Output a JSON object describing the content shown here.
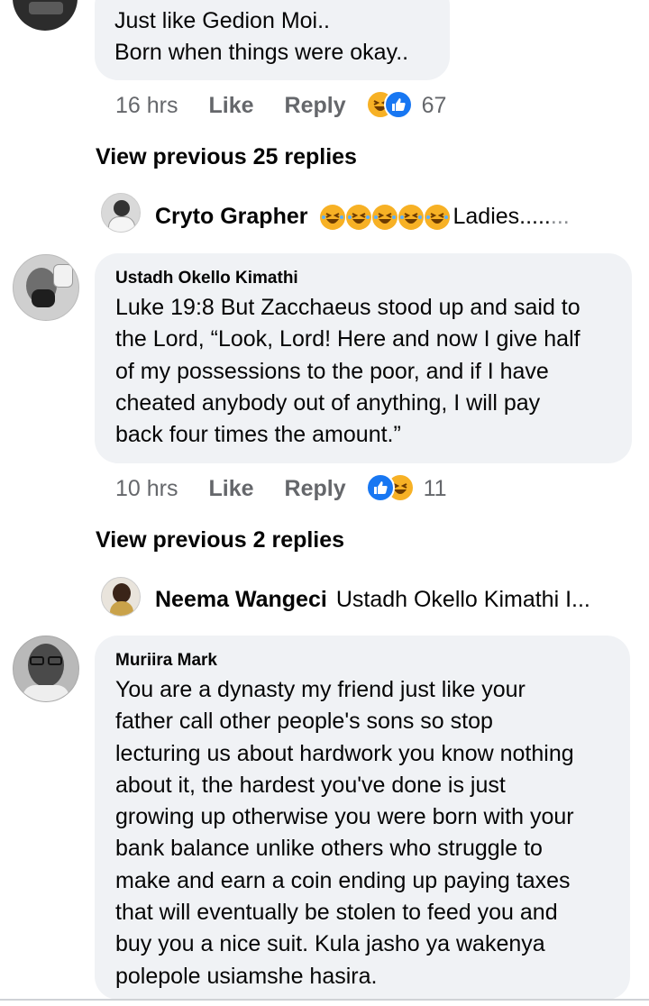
{
  "comment_top": {
    "text_lines": "Just like Gedion Moi..\nBorn when things were okay..",
    "time": "16 hrs",
    "like_label": "Like",
    "reply_label": "Reply",
    "reaction_count": "67",
    "reactions": [
      "haha-icon",
      "like-icon"
    ]
  },
  "view_previous_1": "View previous 25 replies",
  "reply_1": {
    "author": "Cryto Grapher",
    "preview": "Ladies.....",
    "preview_faded": "..."
  },
  "comment_okello": {
    "author": "Ustadh Okello Kimathi",
    "text": "Luke 19:8 But Zacchaeus stood up and said to\nthe Lord, “Look, Lord! Here and now I give half\nof my possessions to the poor, and if I have\ncheated anybody out of anything, I will pay\nback four times the amount.”",
    "time": "10 hrs",
    "like_label": "Like",
    "reply_label": "Reply",
    "reaction_count": "11",
    "reactions": [
      "like-icon",
      "haha-icon"
    ]
  },
  "view_previous_2": "View previous 2 replies",
  "reply_2": {
    "author": "Neema Wangeci",
    "preview": "Ustadh Okello Kimathi I...",
    "preview_faded": ""
  },
  "comment_muriira": {
    "author": "Muriira Mark",
    "text": "You are a dynasty my friend just like your\nfather call other people's sons so stop\nlecturing us about hardwork you know nothing\nabout it, the hardest you've done is just\ngrowing up otherwise you were born with your\nbank balance unlike others who struggle to\nmake and earn a coin ending up paying taxes\nthat will eventually be stolen to feed you and\nbuy you a nice suit. Kula jasho ya wakenya\npolepole usiamshe hasira."
  },
  "colors": {
    "bubble_bg": "#f0f2f5",
    "muted_text": "#65676b",
    "like_blue": "#1877f2",
    "haha_yellow": "#f7b125"
  }
}
